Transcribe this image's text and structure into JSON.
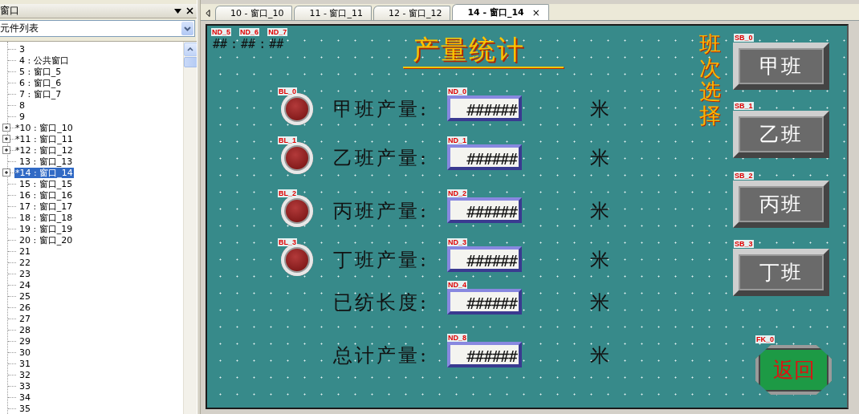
{
  "panel": {
    "title": "窗口",
    "dropdown": "元件列表"
  },
  "tree": [
    {
      "label": "3",
      "expandable": false,
      "selected": false
    },
    {
      "label": "4 : 公共窗口",
      "expandable": false,
      "selected": false
    },
    {
      "label": "5 : 窗口_5",
      "expandable": false,
      "selected": false
    },
    {
      "label": "6 : 窗口_6",
      "expandable": false,
      "selected": false
    },
    {
      "label": "7 : 窗口_7",
      "expandable": false,
      "selected": false
    },
    {
      "label": "8",
      "expandable": false,
      "selected": false
    },
    {
      "label": "9",
      "expandable": false,
      "selected": false
    },
    {
      "label": "*10 : 窗口_10",
      "expandable": true,
      "selected": false
    },
    {
      "label": "*11 : 窗口_11",
      "expandable": true,
      "selected": false
    },
    {
      "label": "*12 : 窗口_12",
      "expandable": true,
      "selected": false
    },
    {
      "label": "13 : 窗口_13",
      "expandable": false,
      "selected": false
    },
    {
      "label": "*14 : 窗口_14",
      "expandable": true,
      "selected": true
    },
    {
      "label": "15 : 窗口_15",
      "expandable": false,
      "selected": false
    },
    {
      "label": "16 : 窗口_16",
      "expandable": false,
      "selected": false
    },
    {
      "label": "17 : 窗口_17",
      "expandable": false,
      "selected": false
    },
    {
      "label": "18 : 窗口_18",
      "expandable": false,
      "selected": false
    },
    {
      "label": "19 : 窗口_19",
      "expandable": false,
      "selected": false
    },
    {
      "label": "20 : 窗口_20",
      "expandable": false,
      "selected": false
    },
    {
      "label": "21",
      "expandable": false,
      "selected": false
    },
    {
      "label": "22",
      "expandable": false,
      "selected": false
    },
    {
      "label": "23",
      "expandable": false,
      "selected": false
    },
    {
      "label": "24",
      "expandable": false,
      "selected": false
    },
    {
      "label": "25",
      "expandable": false,
      "selected": false
    },
    {
      "label": "26",
      "expandable": false,
      "selected": false
    },
    {
      "label": "27",
      "expandable": false,
      "selected": false
    },
    {
      "label": "28",
      "expandable": false,
      "selected": false
    },
    {
      "label": "29",
      "expandable": false,
      "selected": false
    },
    {
      "label": "30",
      "expandable": false,
      "selected": false
    },
    {
      "label": "31",
      "expandable": false,
      "selected": false
    },
    {
      "label": "32",
      "expandable": false,
      "selected": false
    },
    {
      "label": "33",
      "expandable": false,
      "selected": false
    },
    {
      "label": "34",
      "expandable": false,
      "selected": false
    },
    {
      "label": "35",
      "expandable": false,
      "selected": false
    }
  ],
  "tabs": [
    {
      "label": "10 - 窗口_10",
      "selected": false
    },
    {
      "label": "11 - 窗口_11",
      "selected": false
    },
    {
      "label": "12 - 窗口_12",
      "selected": false
    },
    {
      "label": "14 - 窗口_14",
      "selected": true,
      "close": "×"
    }
  ],
  "canvas": {
    "clock": [
      {
        "kind": "field",
        "tag": "ND_5",
        "text": "##"
      },
      {
        "kind": "sep",
        "text": ":"
      },
      {
        "kind": "field",
        "tag": "ND_6",
        "text": "##"
      },
      {
        "kind": "sep",
        "text": ":"
      },
      {
        "kind": "field",
        "tag": "ND_7",
        "text": "##"
      }
    ],
    "title": "产量统计",
    "side_title": "班次选择",
    "rows": [
      {
        "kind": "lamp",
        "lamp_tag": "BL_0",
        "label": "甲班产量:",
        "field_tag": "ND_0",
        "value": "######",
        "unit": "米"
      },
      {
        "kind": "lamp",
        "lamp_tag": "BL_1",
        "label": "乙班产量:",
        "field_tag": "ND_1",
        "value": "######",
        "unit": "米"
      },
      {
        "kind": "lamp",
        "lamp_tag": "BL_2",
        "label": "丙班产量:",
        "field_tag": "ND_2",
        "value": "######",
        "unit": "米"
      },
      {
        "kind": "lamp",
        "lamp_tag": "BL_3",
        "label": "丁班产量:",
        "field_tag": "ND_3",
        "value": "######",
        "unit": "米"
      },
      {
        "kind": "plain",
        "label": "已纺长度:",
        "field_tag": "ND_4",
        "value": "######",
        "unit": "米"
      },
      {
        "kind": "plain",
        "label": "总计产量:",
        "field_tag": "ND_8",
        "value": "######",
        "unit": "米"
      }
    ],
    "shift_buttons": [
      {
        "tag": "SB_0",
        "label": "甲班"
      },
      {
        "tag": "SB_1",
        "label": "乙班"
      },
      {
        "tag": "SB_2",
        "label": "丙班"
      },
      {
        "tag": "SB_3",
        "label": "丁班"
      }
    ],
    "back_button": {
      "tag": "FK_0",
      "label": "返回"
    }
  }
}
